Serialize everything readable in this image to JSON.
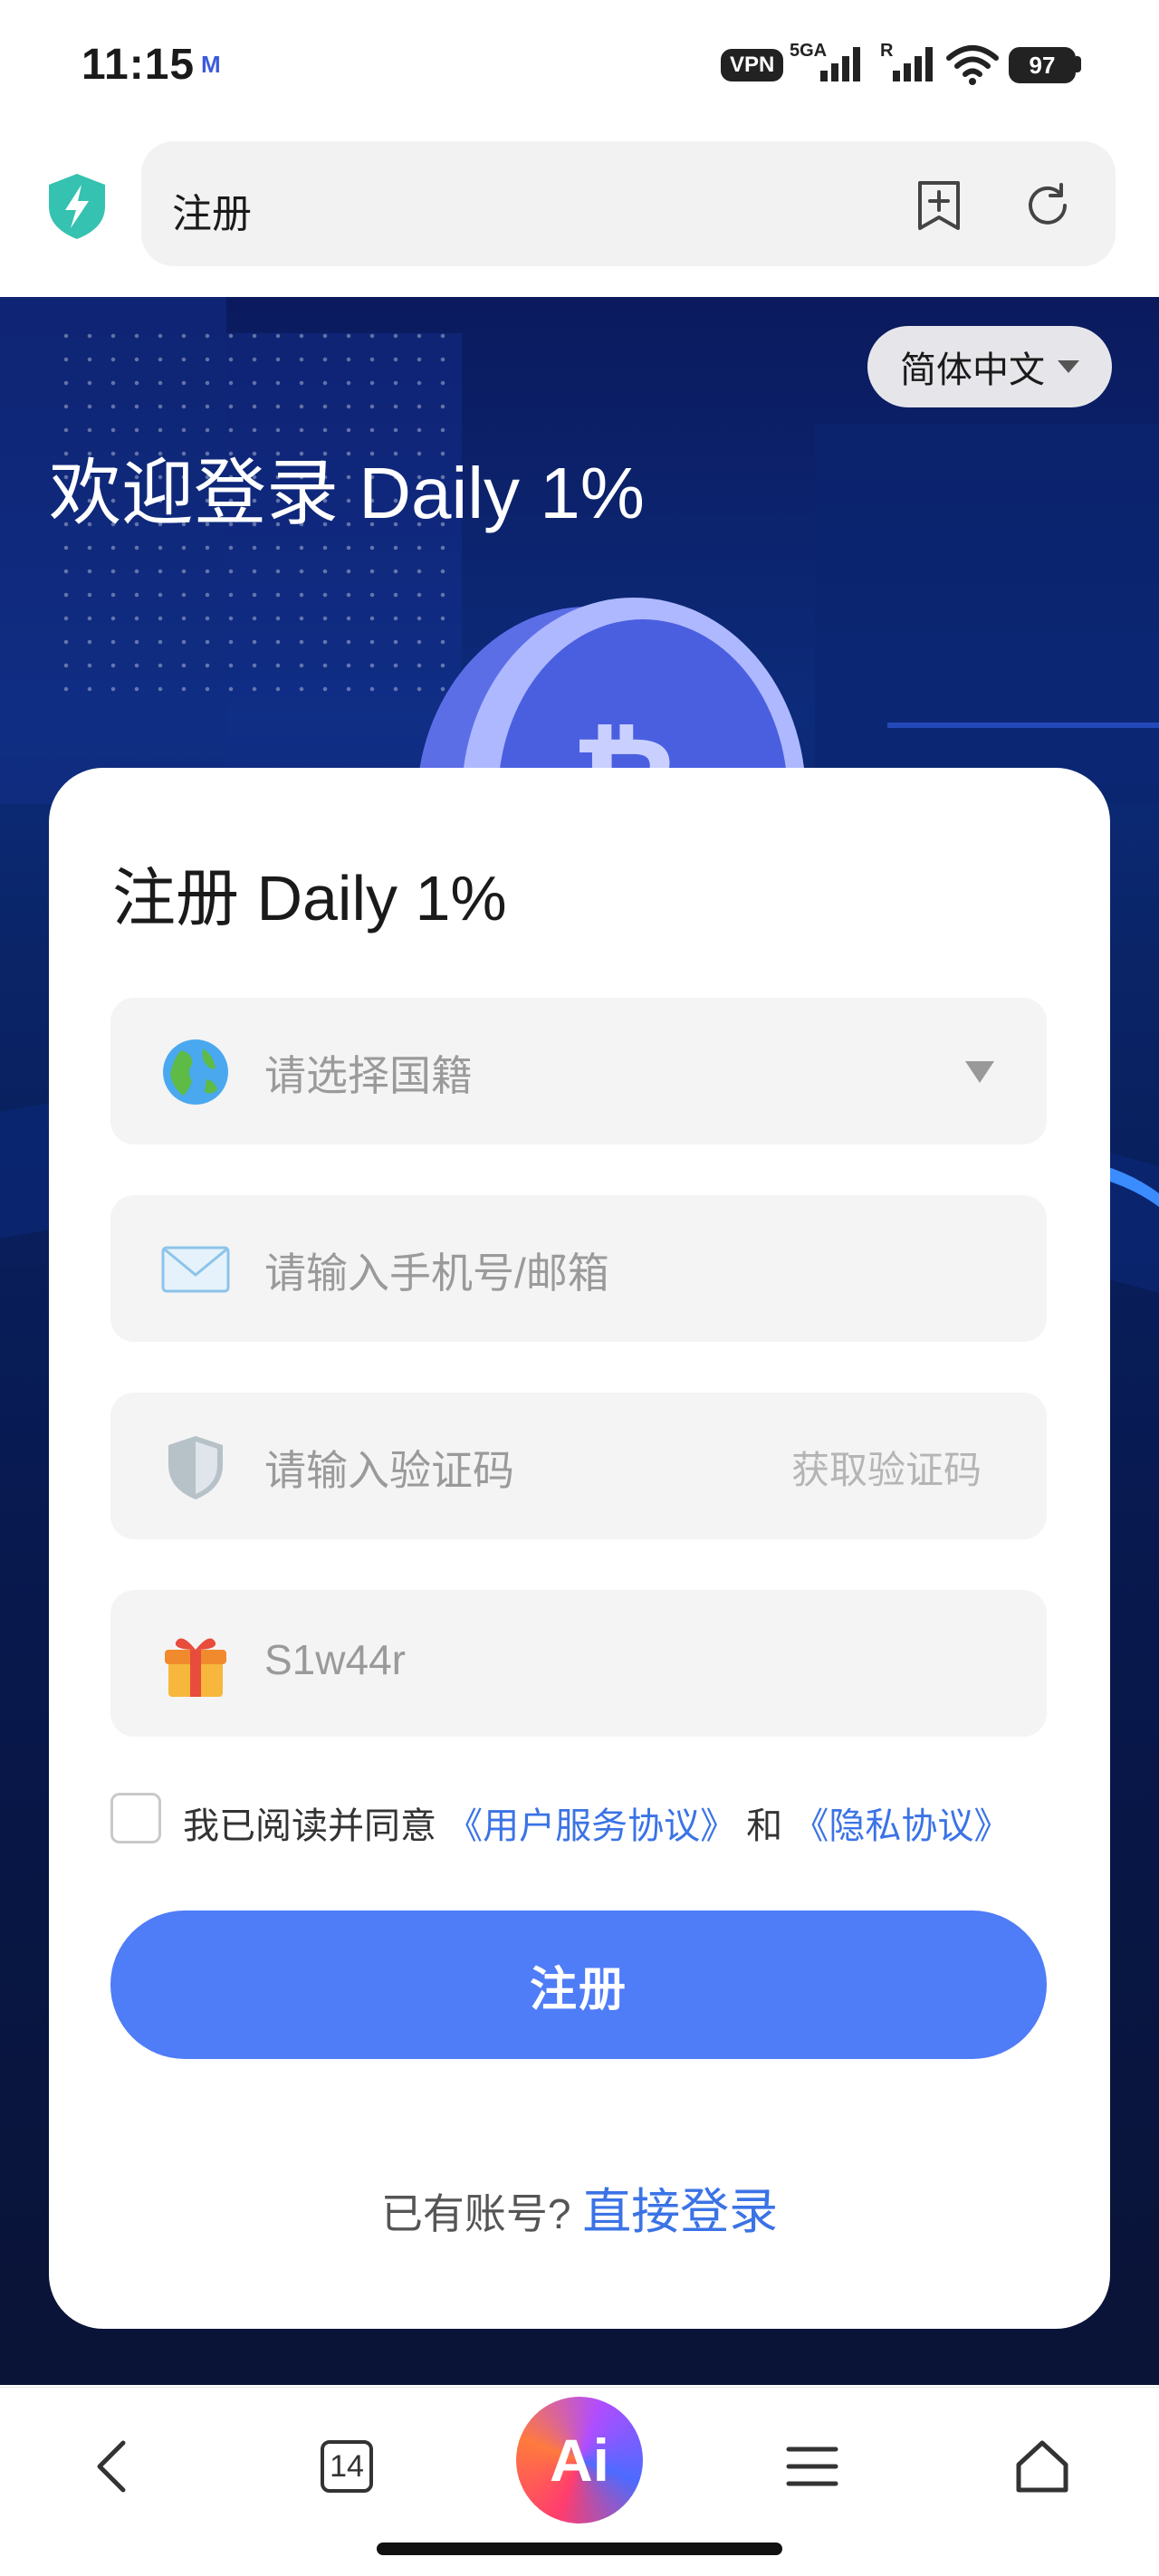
{
  "status_bar": {
    "time": "11:15",
    "notification_icon": "M",
    "vpn_label": "VPN",
    "network_label": "5GA",
    "roaming_label": "R",
    "battery": "97"
  },
  "browser": {
    "url_title": "注册",
    "icons": [
      "shield-icon",
      "bookmark-add-icon",
      "reload-icon"
    ]
  },
  "hero": {
    "language": "简体中文",
    "welcome": "欢迎登录 Daily 1%"
  },
  "form": {
    "title": "注册 Daily 1%",
    "nationality_placeholder": "请选择国籍",
    "account_placeholder": "请输入手机号/邮箱",
    "code_placeholder": "请输入验证码",
    "get_code_label": "获取验证码",
    "invite_code": "S1w44r",
    "agree_prefix": "我已阅读并同意",
    "terms_link": "《用户服务协议》",
    "and_text": "和",
    "privacy_link": "《隐私协议》",
    "submit_label": "注册",
    "have_account": "已有账号?",
    "login_link": "直接登录"
  },
  "bottom_nav": {
    "tab_count": "14",
    "ai_label": "Ai",
    "icons": [
      "back-icon",
      "tabs-icon",
      "ai-icon",
      "menu-icon",
      "home-icon"
    ]
  },
  "colors": {
    "accent": "#4f7cf7",
    "link": "#3b73e6",
    "hero_dark": "#0b1a5e"
  }
}
